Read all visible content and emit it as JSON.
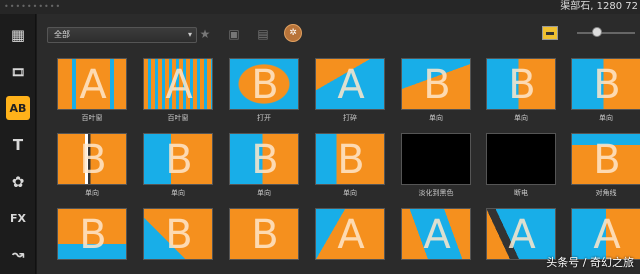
{
  "window": {
    "title_fragment": "渠部石, 1280 72",
    "grip": "••••••••••"
  },
  "sidebar": {
    "items": [
      {
        "name": "media-icon",
        "glyph": "▦"
      },
      {
        "name": "instant-project-icon",
        "glyph": "🎞"
      },
      {
        "name": "transition-icon",
        "glyph": "AB"
      },
      {
        "name": "title-icon",
        "glyph": "T"
      },
      {
        "name": "graphics-icon",
        "glyph": "✿"
      },
      {
        "name": "fx-icon",
        "glyph": "FX"
      },
      {
        "name": "path-icon",
        "glyph": "↝"
      }
    ]
  },
  "toolbar": {
    "category_value": "全部",
    "dropdown_arrow": "▾",
    "icons": [
      {
        "name": "add-favorite-icon",
        "glyph": "★"
      },
      {
        "name": "apply-audio-transition-icon",
        "glyph": "▣"
      },
      {
        "name": "apply-video-transition-icon",
        "glyph": "▤"
      },
      {
        "name": "get-more-icon",
        "glyph": "✲"
      }
    ],
    "view_toggle": "thumbnail-view",
    "zoom_level": 0.25
  },
  "transitions": [
    {
      "label": "百叶窗",
      "style": "blinds-h",
      "letter": "A"
    },
    {
      "label": "百叶窗",
      "style": "blinds-v",
      "letter": "A"
    },
    {
      "label": "打开",
      "style": "open",
      "letter": "B"
    },
    {
      "label": "打碎",
      "style": "shatter",
      "letter": "A"
    },
    {
      "label": "单向",
      "style": "split-diag",
      "letter": "B"
    },
    {
      "label": "单向",
      "style": "half-left",
      "letter": "B"
    },
    {
      "label": "单向",
      "style": "half-left",
      "letter": "B"
    },
    {
      "label": "单向",
      "style": "bar",
      "letter": "B"
    },
    {
      "label": "单向",
      "style": "half-left-A",
      "letter": "B"
    },
    {
      "label": "单向",
      "style": "AB",
      "letter": "B"
    },
    {
      "label": "单向",
      "style": "quarter",
      "letter": "B"
    },
    {
      "label": "淡化到黑色",
      "style": "black",
      "letter": ""
    },
    {
      "label": "断电",
      "style": "black",
      "letter": ""
    },
    {
      "label": "对角线",
      "style": "corner",
      "letter": "B"
    },
    {
      "label": "",
      "style": "bottom-left",
      "letter": "B"
    },
    {
      "label": "",
      "style": "small-A",
      "letter": "B"
    },
    {
      "label": "",
      "style": "top-left",
      "letter": "B"
    },
    {
      "label": "",
      "style": "diag-A",
      "letter": "A"
    },
    {
      "label": "",
      "style": "slash-A",
      "letter": "A"
    },
    {
      "label": "",
      "style": "fold-A",
      "letter": "A"
    },
    {
      "label": "",
      "style": "AB-split",
      "letter": "A"
    }
  ],
  "colors": {
    "orange": "#f5901e",
    "blue": "#18aee8",
    "accent": "#ffb21a"
  },
  "watermark": "头条号 / 奇幻之旅"
}
